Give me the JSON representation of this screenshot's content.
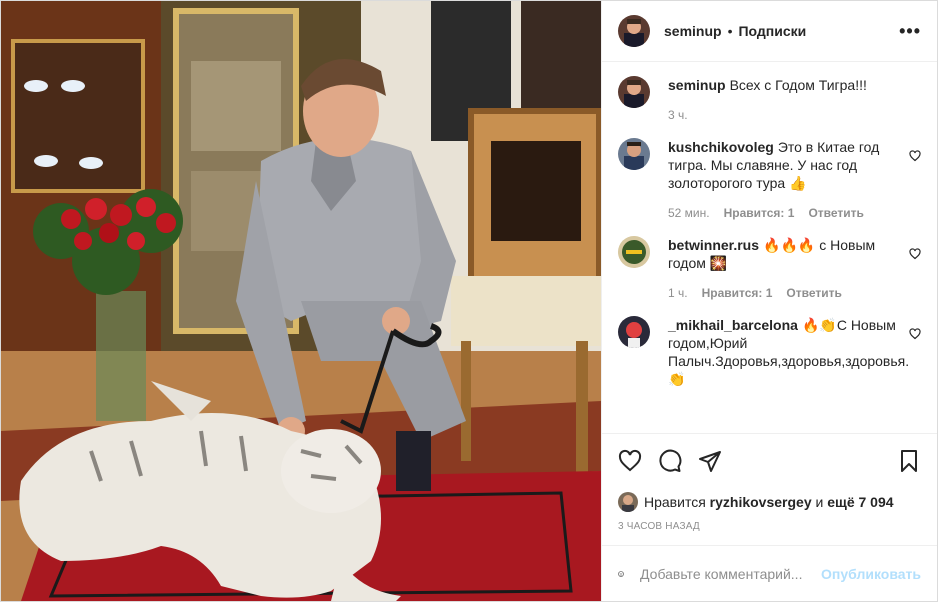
{
  "header": {
    "username": "seminup",
    "separator": "•",
    "follow_label": "Подписки",
    "more_label": "•••"
  },
  "caption": {
    "username": "seminup",
    "text": "Всех с Годом Тигра!!!",
    "time": "3 ч."
  },
  "comments": [
    {
      "username": "kushchikovoleg",
      "text": "Это в Китае год тигра. Мы славяне. У нас год золоторогого тура 👍",
      "time": "52 мин.",
      "likes": "Нравится: 1",
      "reply": "Ответить"
    },
    {
      "username": "betwinner.rus",
      "text": "🔥🔥🔥 с Новым годом 🎇",
      "time": "1 ч.",
      "likes": "Нравится: 1",
      "reply": "Ответить"
    },
    {
      "username": "_mikhail_barcelona",
      "text": "🔥👏С Новым годом,Юрий Палыч.Здоровья,здоровья,здоровья.👏",
      "time": "",
      "likes": "",
      "reply": ""
    }
  ],
  "likes": {
    "prefix": "Нравится",
    "user": "ryzhikovsergey",
    "and": "и",
    "count": "ещё 7 094"
  },
  "post_time": "3 ЧАСОВ НАЗАД",
  "add_comment": {
    "placeholder": "Добавьте комментарий...",
    "publish_label": "Опубликовать"
  },
  "icons": {
    "more": "more-icon",
    "like": "heart-icon",
    "comment": "comment-icon",
    "share": "share-icon",
    "save": "bookmark-icon",
    "emoji": "emoji-icon"
  },
  "colors": {
    "text": "#262626",
    "muted": "#8e8e8e",
    "publish_disabled": "#b2dffc",
    "border": "#dbdbdb"
  }
}
